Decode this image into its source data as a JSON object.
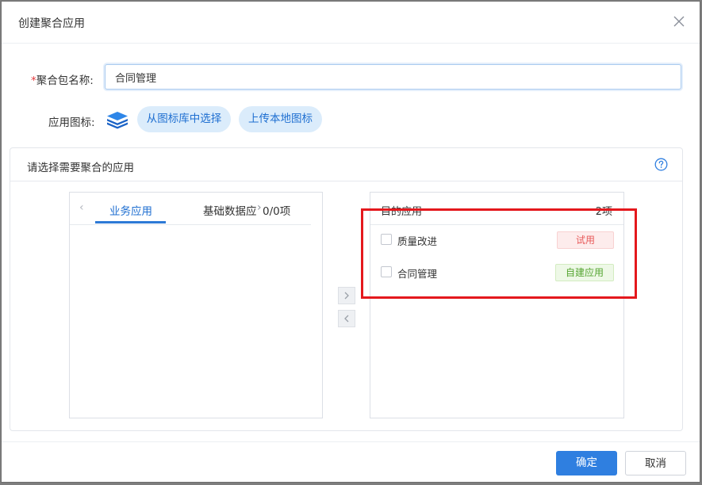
{
  "dialog": {
    "title": "创建聚合应用"
  },
  "form": {
    "name_required_mark": "*",
    "name_label": "聚合包名称:",
    "name_value": "合同管理",
    "icon_label": "应用图标:",
    "icon_name": "layers-icon",
    "pick_from_library": "从图标库中选择",
    "upload_local": "上传本地图标"
  },
  "panel": {
    "title": "请选择需要聚合的应用",
    "help_icon": "question-circle-icon",
    "source": {
      "tabs": [
        {
          "label": "业务应用",
          "active": true
        },
        {
          "label": "基础数据应用",
          "active": false
        }
      ],
      "count": "0/0项"
    },
    "target": {
      "title": "目的应用",
      "count": "2项",
      "items": [
        {
          "label": "质量改进",
          "tag": "试用",
          "tag_color": "#e85a5a"
        },
        {
          "label": "合同管理",
          "tag": "自建应用",
          "tag_color": "#55a532"
        }
      ]
    }
  },
  "colors": {
    "primary": "#2f7fe0",
    "highlight": "#e4181d"
  },
  "footer": {
    "ok": "确定",
    "cancel": "取消"
  }
}
